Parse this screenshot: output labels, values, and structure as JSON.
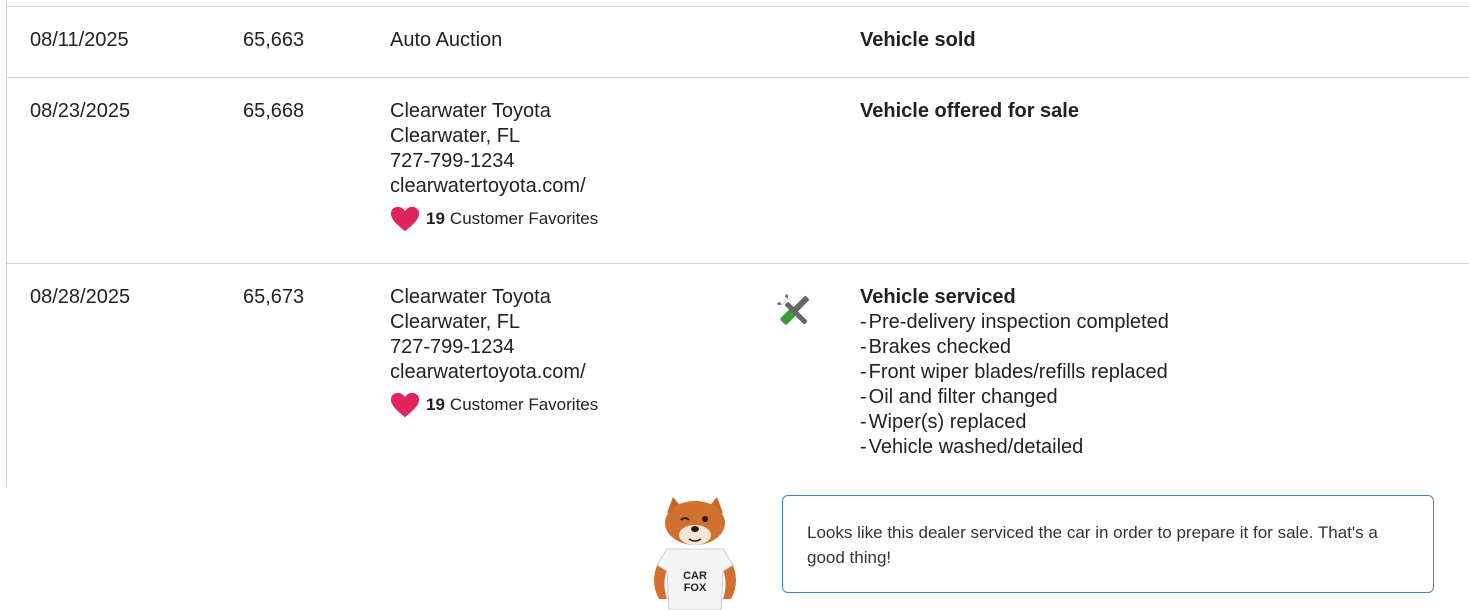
{
  "rows": [
    {
      "date": "08/11/2025",
      "mileage": "65,663",
      "source": {
        "lines": [
          "Auto Auction"
        ]
      },
      "event_title": "Vehicle sold",
      "details": []
    },
    {
      "date": "08/23/2025",
      "mileage": "65,668",
      "source": {
        "lines": [
          "Clearwater Toyota",
          "Clearwater, FL",
          "727-799-1234",
          "clearwatertoyota.com/"
        ],
        "favorites_count": "19",
        "favorites_label": "Customer Favorites"
      },
      "event_title": "Vehicle offered for sale",
      "details": []
    },
    {
      "date": "08/28/2025",
      "mileage": "65,673",
      "source": {
        "lines": [
          "Clearwater Toyota",
          "Clearwater, FL",
          "727-799-1234",
          "clearwatertoyota.com/"
        ],
        "favorites_count": "19",
        "favorites_label": "Customer Favorites"
      },
      "event_icon": "service-tools-icon",
      "event_title": "Vehicle serviced",
      "details": [
        "Pre-delivery inspection completed",
        "Brakes checked",
        "Front wiper blades/refills replaced",
        "Oil and filter changed",
        "Wiper(s) replaced",
        "Vehicle washed/detailed"
      ]
    }
  ],
  "tip": {
    "mascot": "carfox-mascot",
    "mascot_shirt_text": "CAR FOX",
    "text": "Looks like this dealer serviced the car in order to prepare it for sale. That's a good thing!"
  },
  "colors": {
    "divider": "#d6d6d6",
    "heart": "#e0245e",
    "tip_border": "#3a87c8",
    "wrench_green": "#3a9a3a",
    "tool_gray": "#666666"
  }
}
